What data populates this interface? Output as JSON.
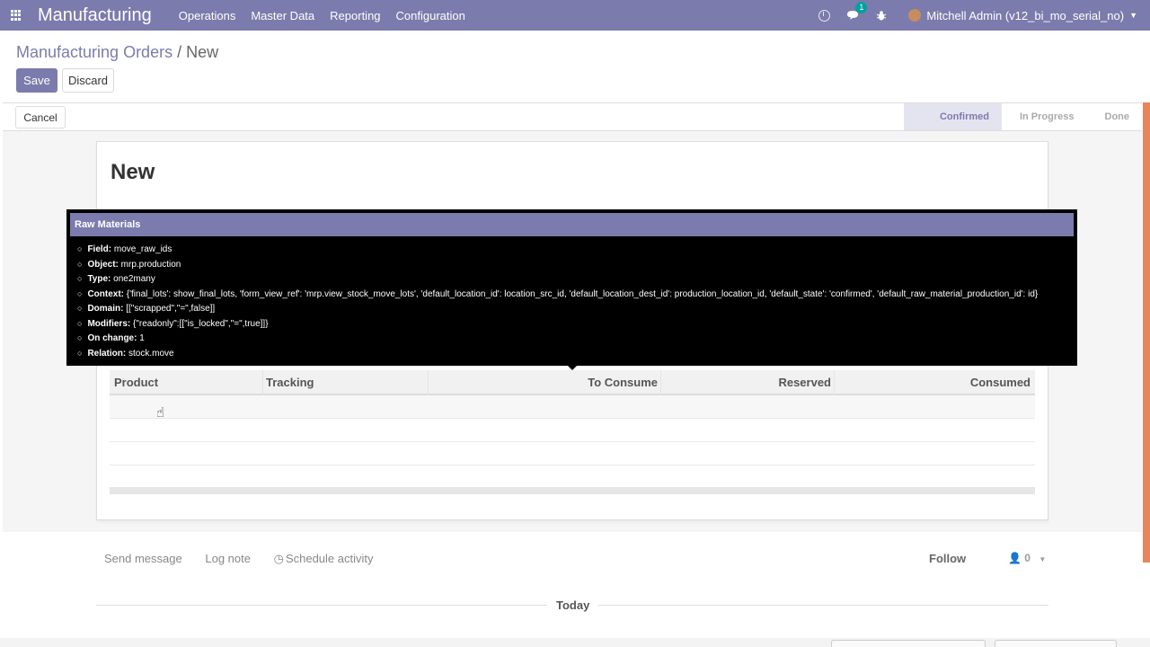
{
  "navbar": {
    "app_title": "Manufacturing",
    "menu": [
      "Operations",
      "Master Data",
      "Reporting",
      "Configuration"
    ],
    "message_badge": "1",
    "user": "Mitchell Admin (v12_bi_mo_serial_no)"
  },
  "breadcrumb": {
    "parent": "Manufacturing Orders",
    "separator": "/",
    "current": "New"
  },
  "actions": {
    "save": "Save",
    "discard": "Discard",
    "cancel": "Cancel"
  },
  "stages": [
    "Confirmed",
    "In Progress",
    "Done"
  ],
  "record": {
    "name": "New"
  },
  "tooltip": {
    "title": "Raw Materials",
    "items": [
      {
        "key": "Field:",
        "value": "move_raw_ids"
      },
      {
        "key": "Object:",
        "value": "mrp.production"
      },
      {
        "key": "Type:",
        "value": "one2many"
      },
      {
        "key": "Context:",
        "value": "{'final_lots': show_final_lots, 'form_view_ref': 'mrp.view_stock_move_lots', 'default_location_id': location_src_id, 'default_location_dest_id': production_location_id, 'default_state': 'confirmed', 'default_raw_material_production_id': id}"
      },
      {
        "key": "Domain:",
        "value": "[[\"scrapped\",\"=\",false]]"
      },
      {
        "key": "Modifiers:",
        "value": "{\"readonly\":[[\"is_locked\",\"=\",true]]}"
      },
      {
        "key": "On change:",
        "value": "1"
      },
      {
        "key": "Relation:",
        "value": "stock.move"
      }
    ]
  },
  "table": {
    "columns": [
      "Product",
      "Tracking",
      "To Consume",
      "Reserved",
      "Consumed"
    ]
  },
  "chatter": {
    "send_message": "Send message",
    "log_note": "Log note",
    "schedule_activity": "Schedule activity",
    "follow": "Follow",
    "followers_count": "0",
    "today": "Today"
  },
  "colors": {
    "brand": "#7c7bad",
    "accent": "#00a09d",
    "status_highlight": "#e9855a"
  }
}
